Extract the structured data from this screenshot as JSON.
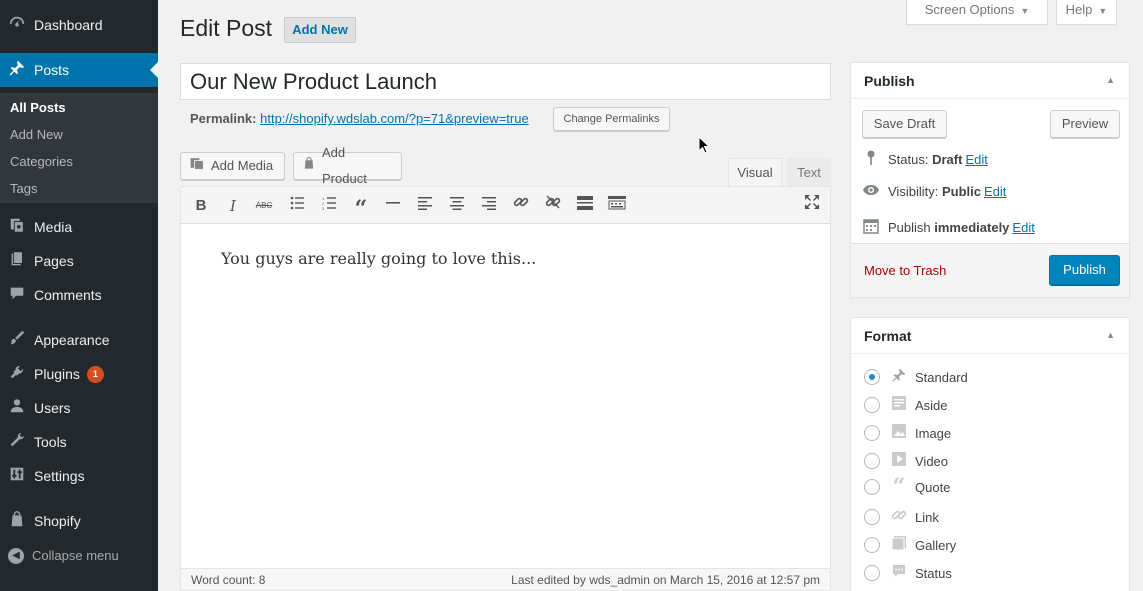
{
  "sidebar": {
    "items": [
      {
        "label": "Dashboard",
        "icon": "dashboard-icon"
      },
      {
        "label": "Posts",
        "icon": "pushpin-icon"
      },
      {
        "label": "Media",
        "icon": "media-icon"
      },
      {
        "label": "Pages",
        "icon": "pages-icon"
      },
      {
        "label": "Comments",
        "icon": "comments-icon"
      },
      {
        "label": "Appearance",
        "icon": "paintbrush-icon"
      },
      {
        "label": "Plugins",
        "icon": "plugin-icon",
        "badge": "1"
      },
      {
        "label": "Users",
        "icon": "users-icon"
      },
      {
        "label": "Tools",
        "icon": "wrench-icon"
      },
      {
        "label": "Settings",
        "icon": "settings-icon"
      },
      {
        "label": "Shopify",
        "icon": "shopify-bag-icon"
      }
    ],
    "submenu": [
      "All Posts",
      "Add New",
      "Categories",
      "Tags"
    ],
    "collapse_label": "Collapse menu"
  },
  "header": {
    "title": "Edit Post",
    "add_new": "Add New",
    "screen_options": "Screen Options",
    "help": "Help"
  },
  "post": {
    "title": "Our New Product Launch",
    "permalink_label": "Permalink:",
    "permalink_url": "http://shopify.wdslab.com/?p=71&preview=true",
    "change_permalinks": "Change Permalinks",
    "content": "You guys are really going to love this..."
  },
  "editor": {
    "add_media": "Add Media",
    "add_product": "Add Product",
    "tab_visual": "Visual",
    "tab_text": "Text",
    "word_count": "Word count: 8",
    "last_edited": "Last edited by wds_admin on March 15, 2016 at 12:57 pm",
    "toolbar": [
      "bold-icon",
      "italic-icon",
      "strikethrough-icon",
      "bullet-list-icon",
      "numbered-list-icon",
      "blockquote-icon",
      "horizontal-rule-icon",
      "align-left-icon",
      "align-center-icon",
      "align-right-icon",
      "link-icon",
      "unlink-icon",
      "read-more-icon",
      "toolbar-toggle-icon",
      "fullscreen-icon"
    ]
  },
  "publish": {
    "heading": "Publish",
    "save_draft": "Save Draft",
    "preview": "Preview",
    "status_label": "Status:",
    "status_value": "Draft",
    "visibility_label": "Visibility:",
    "visibility_value": "Public",
    "publish_label": "Publish",
    "publish_value": "immediately",
    "edit": "Edit",
    "trash": "Move to Trash",
    "publish_button": "Publish"
  },
  "format": {
    "heading": "Format",
    "options": [
      {
        "label": "Standard",
        "icon": "pushpin-icon",
        "checked": true
      },
      {
        "label": "Aside",
        "icon": "aside-icon",
        "checked": false
      },
      {
        "label": "Image",
        "icon": "image-icon",
        "checked": false
      },
      {
        "label": "Video",
        "icon": "video-icon",
        "checked": false
      },
      {
        "label": "Quote",
        "icon": "quote-icon",
        "checked": false
      },
      {
        "label": "Link",
        "icon": "link-icon",
        "checked": false
      },
      {
        "label": "Gallery",
        "icon": "gallery-icon",
        "checked": false
      },
      {
        "label": "Status",
        "icon": "status-bubble-icon",
        "checked": false
      }
    ]
  },
  "colors": {
    "sidebar_bg": "#23282d",
    "accent": "#0073aa",
    "primary_button": "#0085ba",
    "trash": "#a00",
    "badge": "#d54e21"
  }
}
